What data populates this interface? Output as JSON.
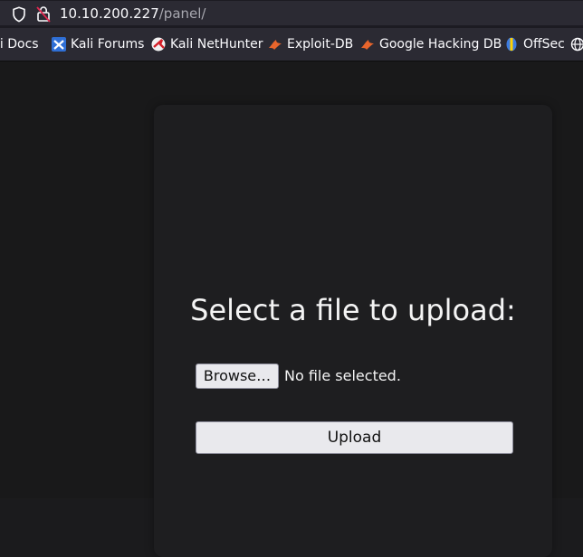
{
  "browser": {
    "url_host": "10.10.200.227",
    "url_path": "/panel/"
  },
  "bookmarks": [
    {
      "label": "li Docs",
      "icon": "kali-docs-icon"
    },
    {
      "label": "Kali Forums",
      "icon": "kali-forums-icon"
    },
    {
      "label": "Kali NetHunter",
      "icon": "kali-nethunter-icon"
    },
    {
      "label": "Exploit-DB",
      "icon": "exploit-db-icon"
    },
    {
      "label": "Google Hacking DB",
      "icon": "google-hacking-db-icon"
    },
    {
      "label": "OffSec",
      "icon": "offsec-icon"
    }
  ],
  "page": {
    "heading": "Select a file to upload:",
    "browse_label": "Browse…",
    "file_status": "No file selected.",
    "upload_label": "Upload"
  },
  "colors": {
    "background": "#19191a",
    "panel": "#1e1e20",
    "button": "#e9e9ed",
    "text": "#f4f4f4",
    "exploitdb_orange": "#e8652c"
  }
}
